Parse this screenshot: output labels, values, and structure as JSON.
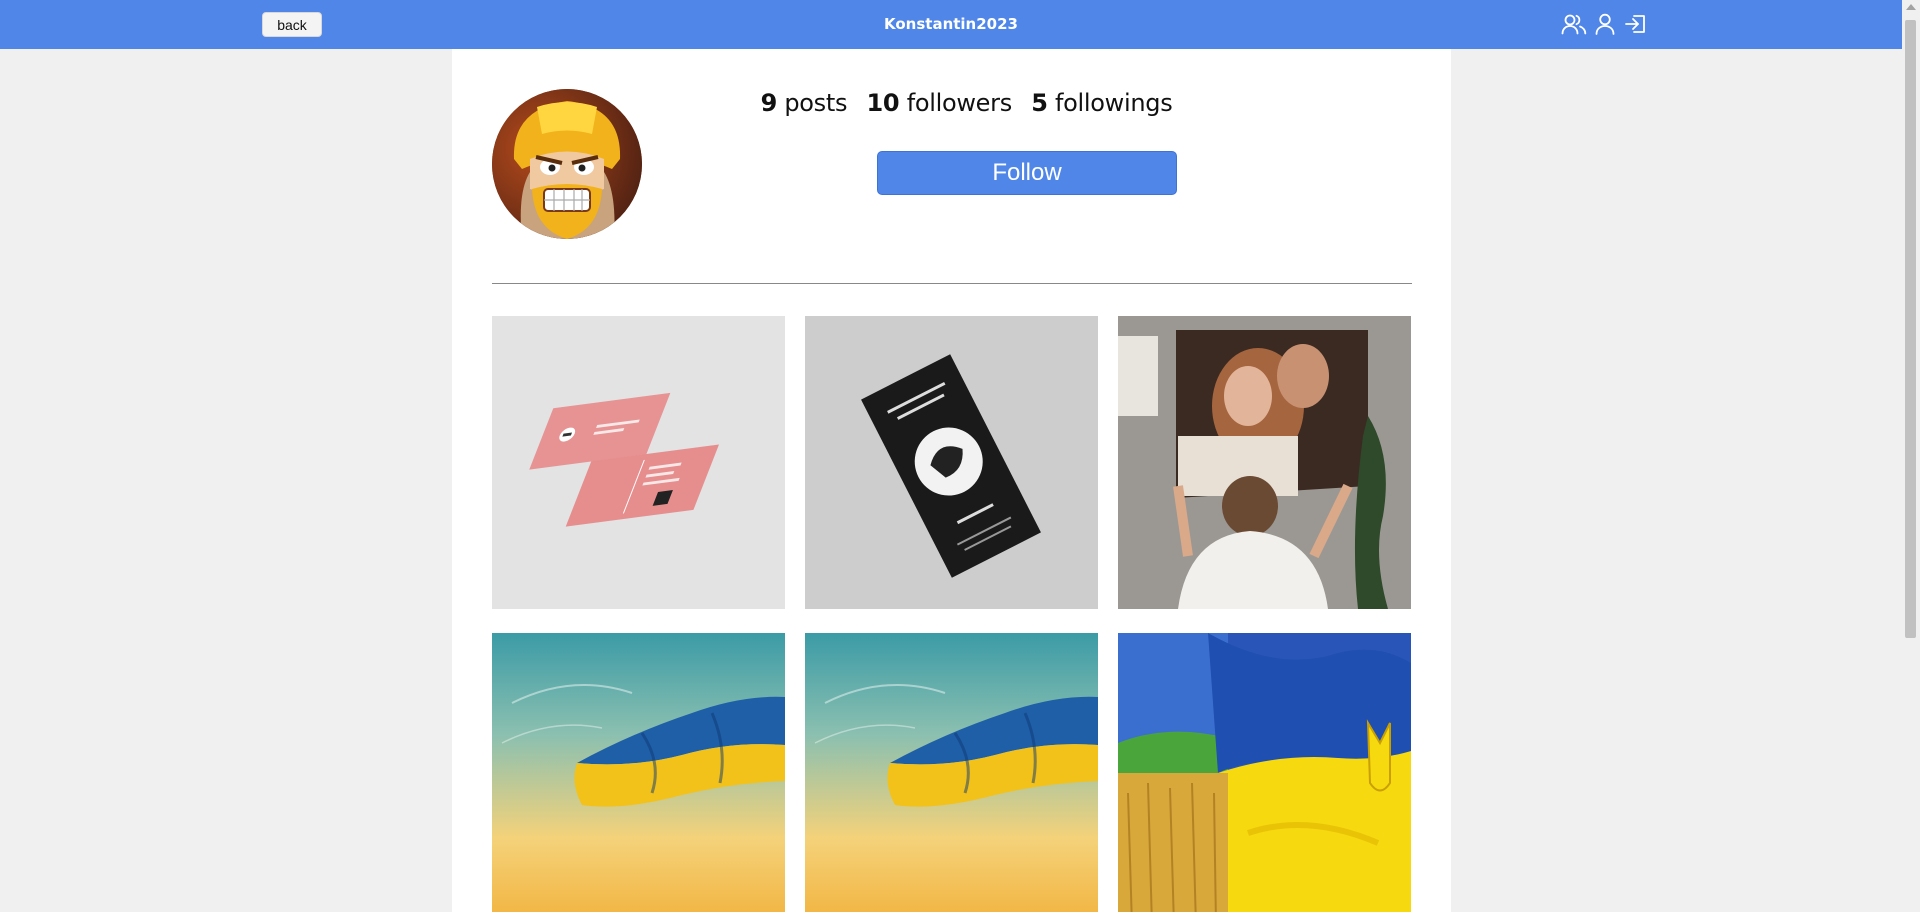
{
  "header": {
    "back_label": "back",
    "title": "Konstantin2023",
    "icons": [
      "users-icon",
      "profile-icon",
      "logout-icon"
    ]
  },
  "profile": {
    "stats": {
      "posts_count": "9",
      "posts_label": "posts",
      "followers_count": "10",
      "followers_label": "followers",
      "followings_count": "5",
      "followings_label": "followings"
    },
    "follow_label": "Follow"
  },
  "colors": {
    "accent": "#4f86e8",
    "page_bg": "#f0f0f0",
    "card_bg": "#ffffff"
  },
  "posts": [
    {
      "name": "business-card-mockup"
    },
    {
      "name": "restaurant-flyer-mockup"
    },
    {
      "name": "couple-canvas-photo"
    },
    {
      "name": "ukraine-flag-sky"
    },
    {
      "name": "ukraine-flag-sky-2"
    },
    {
      "name": "ukraine-flag-wheat-field"
    }
  ]
}
